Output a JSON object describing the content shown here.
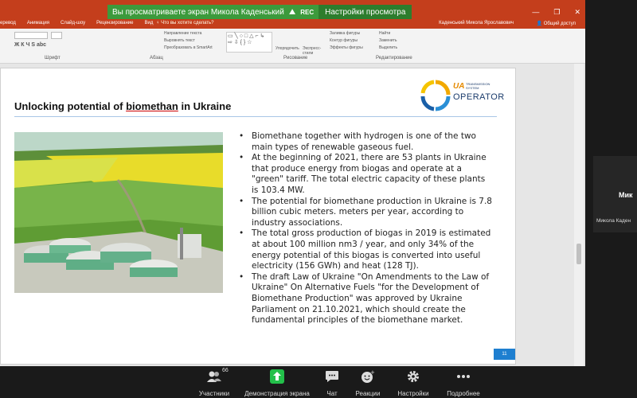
{
  "zoom": {
    "share_message": "Вы просматриваете экран Микола Каденський",
    "rec_label": "REC",
    "view_options_button": "Настройки просмотра",
    "toolbar": [
      {
        "label": "Участники",
        "icon": "participants-icon",
        "count": "66"
      },
      {
        "label": "Демонстрация экрана",
        "icon": "share-screen-icon"
      },
      {
        "label": "Чат",
        "icon": "chat-icon"
      },
      {
        "label": "Реакции",
        "icon": "reactions-icon"
      },
      {
        "label": "Настройки",
        "icon": "settings-icon"
      },
      {
        "label": "Подробнее",
        "icon": "more-icon"
      }
    ],
    "video_tile": {
      "name": "Мик",
      "subtitle": "Микола Каден"
    }
  },
  "ppt": {
    "tabs": [
      "еревод",
      "Анимация",
      "Слайд-шоу",
      "Рецензирование",
      "Вид"
    ],
    "tell_me": "Что вы хотите сделать?",
    "user": "Каденський Микола Ярославович",
    "share": "Общий доступ",
    "groups": [
      "Шрифт",
      "Абзац",
      "Рисование",
      "Редактирование"
    ],
    "tools": {
      "direction": "Направление текста",
      "align": "Выровнять текст",
      "smartart": "Преобразовать в SmartArt",
      "arrange": "Упорядочить",
      "styles": "Экспресс-стили",
      "fill": "Заливка фигуры",
      "outline": "Контур фигуры",
      "effects": "Эффекты фигуры",
      "find": "Найти",
      "replace": "Заменить",
      "select": "Выделить"
    }
  },
  "slide": {
    "title_pre": "Unlocking potential of ",
    "title_u": "biomethan",
    "title_post": " in Ukraine",
    "logo_ua": "UA",
    "logo_sub": "TRANSMISSION SYSTEM",
    "logo_operator": "OPERATOR",
    "bullets": [
      "Biomethane together with hydrogen is one of the two main types of renewable gaseous fuel.",
      "At the beginning of 2021, there are 53 plants in Ukraine that produce energy from biogas and operate at a \"green\" tariff. The total electric capacity of these plants is 103.4 MW.",
      "The potential for biomethane production in Ukraine is 7.8 billion cubic meters. meters per year, according to industry associations.",
      "The total gross production of biogas in 2019 is estimated at about 100 million nm3 / year, and only 34% of the energy potential of this biogas is converted into useful electricity (156 GWh) and heat (128 TJ).",
      "The draft Law of Ukraine \"On Amendments to the Law of Ukraine\" On Alternative Fuels \"for the Development of Biomethane Production\" was approved by Ukraine Parliament on 21.10.2021, which should create the fundamental principles of the biomethane market."
    ],
    "page_number": "11"
  }
}
